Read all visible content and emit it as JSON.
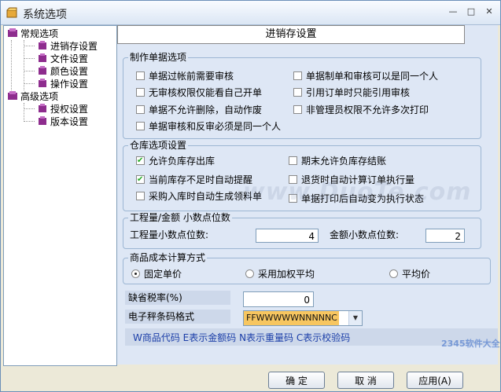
{
  "window": {
    "title": "系统选项"
  },
  "tree": {
    "groups": [
      {
        "label": "常规选项",
        "children": [
          "进销存设置",
          "文件设置",
          "颜色设置",
          "操作设置"
        ]
      },
      {
        "label": "高级选项",
        "children": [
          "授权设置",
          "版本设置"
        ]
      }
    ]
  },
  "panel": {
    "title": "进销存设置"
  },
  "doc_group": {
    "title": "制作单据选项",
    "options": [
      {
        "label": "单据过帐前需要审核",
        "checked": false
      },
      {
        "label": "单据制单和审核可以是同一个人",
        "checked": false
      },
      {
        "label": "无审核权限仅能看自己开单",
        "checked": false
      },
      {
        "label": "引用订单时只能引用审核",
        "checked": false
      },
      {
        "label": "单据不允许删除，自动作废",
        "checked": false
      },
      {
        "label": "非管理员权限不允许多次打印",
        "checked": false
      },
      {
        "label": "单据审核和反审必须是同一个人",
        "checked": false
      }
    ]
  },
  "warehouse_group": {
    "title": "仓库选项设置",
    "options": [
      {
        "label": "允许负库存出库",
        "checked": true
      },
      {
        "label": "期末允许负库存结账",
        "checked": false
      },
      {
        "label": "当前库存不足时自动提醒",
        "checked": true
      },
      {
        "label": "退货时自动计算订单执行量",
        "checked": false
      },
      {
        "label": "采购入库时自动生成领料单",
        "checked": false
      },
      {
        "label": "单据打印后自动变为执行状态",
        "checked": false
      }
    ]
  },
  "decimal_group": {
    "title": "工程量/金额  小数点位数",
    "qty_label": "工程量小数点位数:",
    "qty_value": "4",
    "amount_label": "金额小数点位数:",
    "amount_value": "2"
  },
  "cost_group": {
    "title": "商品成本计算方式",
    "options": [
      {
        "label": "固定单价",
        "checked": true
      },
      {
        "label": "采用加权平均",
        "checked": false
      },
      {
        "label": "平均价",
        "checked": false
      }
    ]
  },
  "tax": {
    "label": "缺省税率(%)",
    "value": "0"
  },
  "barcode": {
    "label": "电子秤条码格式",
    "value": "FFWWWWWNNNNNC"
  },
  "barcode_hint": "W商品代码 E表示金额码 N表示重量码 C表示校验码",
  "buttons": {
    "ok": "确  定",
    "cancel": "取  消",
    "apply": "应用(A)"
  },
  "watermark": {
    "text": "www.DuoTe.com",
    "brand": "2345软件大全"
  }
}
